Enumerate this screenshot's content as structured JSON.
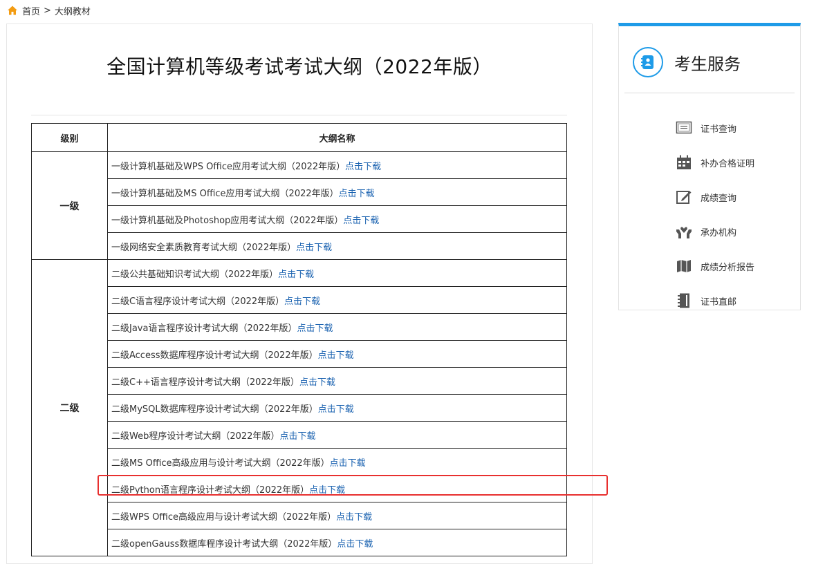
{
  "breadcrumb": {
    "home": "首页",
    "separator": ">",
    "current": "大纲教材"
  },
  "page_title": "全国计算机等级考试考试大纲（2022年版）",
  "table": {
    "headers": {
      "level": "级别",
      "name": "大纲名称"
    },
    "groups": [
      {
        "level": "一级",
        "rows": [
          {
            "title": "一级计算机基础及WPS Office应用考试大纲（2022年版）",
            "link": "点击下载"
          },
          {
            "title": "一级计算机基础及MS Office应用考试大纲（2022年版）",
            "link": "点击下载"
          },
          {
            "title": "一级计算机基础及Photoshop应用考试大纲（2022年版）",
            "link": "点击下载"
          },
          {
            "title": "一级网络安全素质教育考试大纲（2022年版）",
            "link": "点击下载"
          }
        ]
      },
      {
        "level": "二级",
        "rows": [
          {
            "title": "二级公共基础知识考试大纲（2022年版）",
            "link": "点击下载"
          },
          {
            "title": "二级C语言程序设计考试大纲（2022年版）",
            "link": "点击下载"
          },
          {
            "title": "二级Java语言程序设计考试大纲（2022年版）",
            "link": "点击下载"
          },
          {
            "title": "二级Access数据库程序设计考试大纲（2022年版）",
            "link": "点击下载"
          },
          {
            "title": "二级C++语言程序设计考试大纲（2022年版）",
            "link": "点击下载"
          },
          {
            "title": "二级MySQL数据库程序设计考试大纲（2022年版）",
            "link": "点击下载"
          },
          {
            "title": "二级Web程序设计考试大纲（2022年版）",
            "link": "点击下载"
          },
          {
            "title": "二级MS Office高级应用与设计考试大纲（2022年版）",
            "link": "点击下载"
          },
          {
            "title": "二级Python语言程序设计考试大纲（2022年版）",
            "link": "点击下载"
          },
          {
            "title": "二级WPS Office高级应用与设计考试大纲（2022年版）",
            "link": "点击下载"
          },
          {
            "title": "二级openGauss数据库程序设计考试大纲（2022年版）",
            "link": "点击下载"
          }
        ]
      }
    ]
  },
  "sidebar": {
    "title": "考生服务",
    "items": [
      {
        "label": "证书查询",
        "icon": "certificate-icon"
      },
      {
        "label": "补办合格证明",
        "icon": "calendar-icon"
      },
      {
        "label": "成绩查询",
        "icon": "edit-icon"
      },
      {
        "label": "承办机构",
        "icon": "hands-icon"
      },
      {
        "label": "成绩分析报告",
        "icon": "map-icon"
      },
      {
        "label": "证书直邮",
        "icon": "notebook-icon"
      }
    ]
  },
  "colors": {
    "accent": "#1e9be8",
    "link": "#1a62b0",
    "highlight": "#e8302f",
    "home_icon": "#f39c12"
  }
}
